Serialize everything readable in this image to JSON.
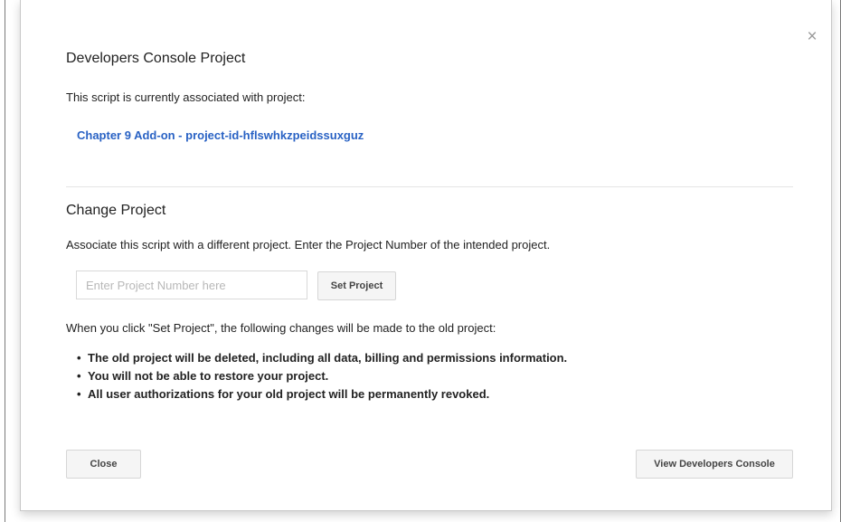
{
  "dialog": {
    "close_icon_glyph": "×",
    "title": "Developers Console Project",
    "associated_text": "This script is currently associated with project:",
    "project_link": "Chapter 9 Add-on - project-id-hflswhkzpeidssuxguz",
    "change_section": {
      "title": "Change Project",
      "description": "Associate this script with a different project. Enter the Project Number of the intended project.",
      "input_placeholder": "Enter Project Number here",
      "input_value": "",
      "set_button_label": "Set Project"
    },
    "warning": {
      "intro": "When you click \"Set Project\", the following changes will be made to the old project:",
      "bullet_glyph": "•",
      "items": [
        "The old project will be deleted, including all data, billing and permissions information.",
        "You will not be able to restore your project.",
        "All user authorizations for your old project will be permanently revoked."
      ]
    },
    "footer": {
      "close_label": "Close",
      "view_console_label": "View Developers Console"
    }
  },
  "colors": {
    "link": "#2962c4",
    "text": "#222222",
    "button_bg": "#f5f5f5",
    "close_icon": "#9a9a9a"
  }
}
